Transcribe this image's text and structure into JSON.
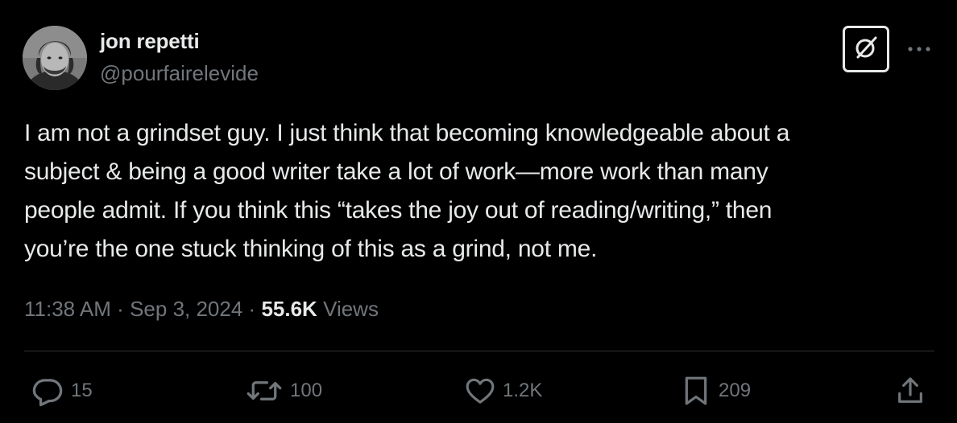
{
  "author": {
    "display_name": "jon repetti",
    "handle": "@pourfairelevide"
  },
  "post": {
    "text": "I am not a grindset guy. I just think that becoming knowledgeable about a\nsubject & being a good writer take a lot of work—more work than many\npeople admit. If you think this “takes the joy out of reading/writing,” then\nyou’re the one stuck thinking of this as a grind, not me.",
    "time": "11:38 AM",
    "separator": "·",
    "date": "Sep 3, 2024",
    "views_count": "55.6K",
    "views_label": "Views"
  },
  "actions": {
    "replies": "15",
    "reposts": "100",
    "likes": "1.2K",
    "bookmarks": "209"
  },
  "icons": {
    "grok": "grok-icon",
    "more": "more-horizontal-icon",
    "reply": "reply-icon",
    "repost": "repost-icon",
    "like": "heart-icon",
    "bookmark": "bookmark-icon",
    "share": "share-icon"
  },
  "colors": {
    "background": "#000000",
    "primary_text": "#e7e9ea",
    "secondary_text": "#71767b",
    "divider": "#2f3336"
  }
}
